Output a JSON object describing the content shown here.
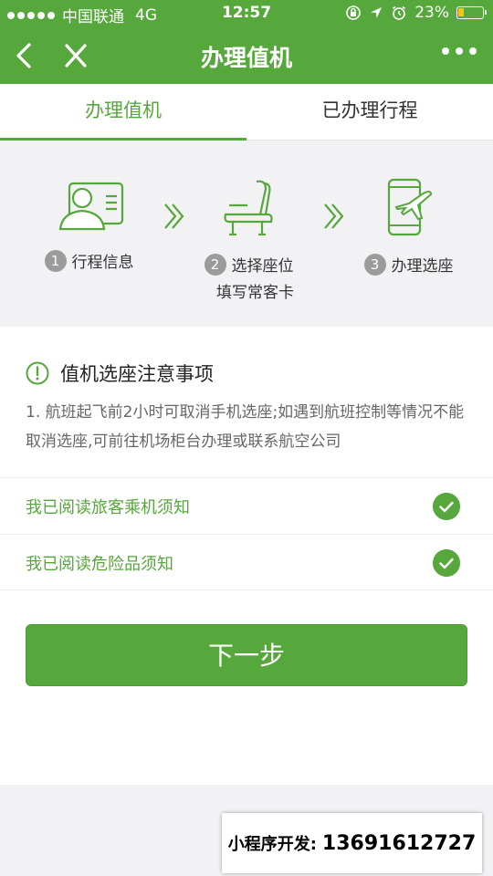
{
  "status_bar": {
    "carrier": "中国联通",
    "network": "4G",
    "time": "12:57",
    "battery": "23%",
    "battery_level": 0.23
  },
  "nav": {
    "title": "办理值机"
  },
  "tabs": [
    {
      "label": "办理值机",
      "active": true
    },
    {
      "label": "已办理行程",
      "active": false
    }
  ],
  "steps": [
    {
      "num": "1",
      "label": "行程信息",
      "sub": ""
    },
    {
      "num": "2",
      "label": "选择座位",
      "sub": "填写常客卡"
    },
    {
      "num": "3",
      "label": "办理选座",
      "sub": ""
    }
  ],
  "notice": {
    "title": "值机选座注意事项",
    "text": "1. 航班起飞前2小时可取消手机选座;如遇到航班控制等情况不能取消选座,可前往机场柜台办理或联系航空公司",
    "checks": [
      {
        "label": "我已阅读旅客乘机须知",
        "checked": true
      },
      {
        "label": "我已阅读危险品须知",
        "checked": true
      }
    ],
    "next_label": "下一步"
  },
  "promo": {
    "label": "小程序开发:",
    "phone": "13691612727"
  },
  "colors": {
    "brand_green": "#56a83c",
    "battery_yellow": "#f5c518"
  }
}
